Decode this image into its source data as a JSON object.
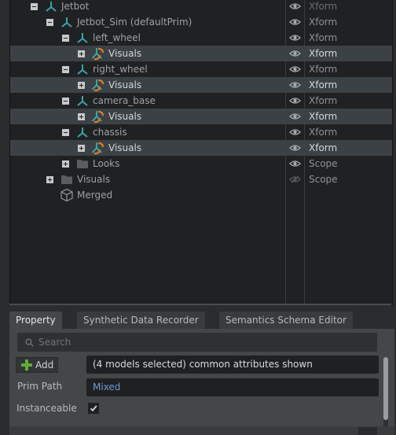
{
  "stage": {
    "rows": [
      {
        "id": "jetbot",
        "label": "Jetbot",
        "type": "Xform",
        "indent": 0,
        "expander": "minus",
        "icon": "xform-axis-icon",
        "selected": false,
        "cut": true,
        "eye": "visible"
      },
      {
        "id": "jetbot-sim",
        "label": "Jetbot_Sim (defaultPrim)",
        "type": "Xform",
        "indent": 1,
        "expander": "minus",
        "icon": "xform-axis-icon",
        "selected": false,
        "eye": "visible"
      },
      {
        "id": "left-wheel",
        "label": "left_wheel",
        "type": "Xform",
        "indent": 2,
        "expander": "minus",
        "icon": "xform-axis-icon",
        "selected": false,
        "eye": "visible"
      },
      {
        "id": "left-wheel-visuals",
        "label": "Visuals",
        "type": "Xform",
        "indent": 3,
        "expander": "plus",
        "icon": "reference-xform-icon",
        "selected": true,
        "eye": "visible"
      },
      {
        "id": "right-wheel",
        "label": "right_wheel",
        "type": "Xform",
        "indent": 2,
        "expander": "minus",
        "icon": "xform-axis-icon",
        "selected": false,
        "eye": "visible"
      },
      {
        "id": "right-wheel-visuals",
        "label": "Visuals",
        "type": "Xform",
        "indent": 3,
        "expander": "plus",
        "icon": "reference-xform-icon",
        "selected": true,
        "eye": "visible"
      },
      {
        "id": "camera-base",
        "label": "camera_base",
        "type": "Xform",
        "indent": 2,
        "expander": "minus",
        "icon": "xform-axis-icon",
        "selected": false,
        "eye": "visible"
      },
      {
        "id": "camera-base-visuals",
        "label": "Visuals",
        "type": "Xform",
        "indent": 3,
        "expander": "plus",
        "icon": "reference-xform-icon",
        "selected": true,
        "eye": "visible"
      },
      {
        "id": "chassis",
        "label": "chassis",
        "type": "Xform",
        "indent": 2,
        "expander": "minus",
        "icon": "xform-axis-icon",
        "selected": false,
        "eye": "visible"
      },
      {
        "id": "chassis-visuals",
        "label": "Visuals",
        "type": "Xform",
        "indent": 3,
        "expander": "plus",
        "icon": "reference-xform-icon",
        "selected": true,
        "eye": "visible"
      },
      {
        "id": "looks",
        "label": "Looks",
        "type": "Scope",
        "indent": 2,
        "expander": "plus",
        "icon": "folder-icon",
        "selected": false,
        "eye": "visible"
      },
      {
        "id": "visuals-scope",
        "label": "Visuals",
        "type": "Scope",
        "indent": 1,
        "expander": "plus",
        "icon": "folder-icon",
        "selected": false,
        "eye": "hidden"
      },
      {
        "id": "merged",
        "label": "Merged",
        "type": "",
        "indent": 1,
        "expander": "none",
        "icon": "cube-icon",
        "selected": false,
        "eye": "none"
      }
    ]
  },
  "tabs": [
    {
      "label": "Property",
      "active": true
    },
    {
      "label": "Synthetic Data Recorder",
      "active": false
    },
    {
      "label": "Semantics Schema Editor",
      "active": false
    }
  ],
  "property": {
    "search_placeholder": "Search",
    "add_label": "Add",
    "summary": "(4 models selected) common attributes shown",
    "prim_path_label": "Prim Path",
    "prim_path_value": "Mixed",
    "instanceable_label": "Instanceable",
    "instanceable_checked": true
  },
  "colors": {
    "selected_row": "#3c4145",
    "prim_path_value": "#6c9bd2",
    "add_plus": "#5fae37",
    "xform_teal": "#3aa6a6",
    "reference_orange": "#e07b2a"
  }
}
